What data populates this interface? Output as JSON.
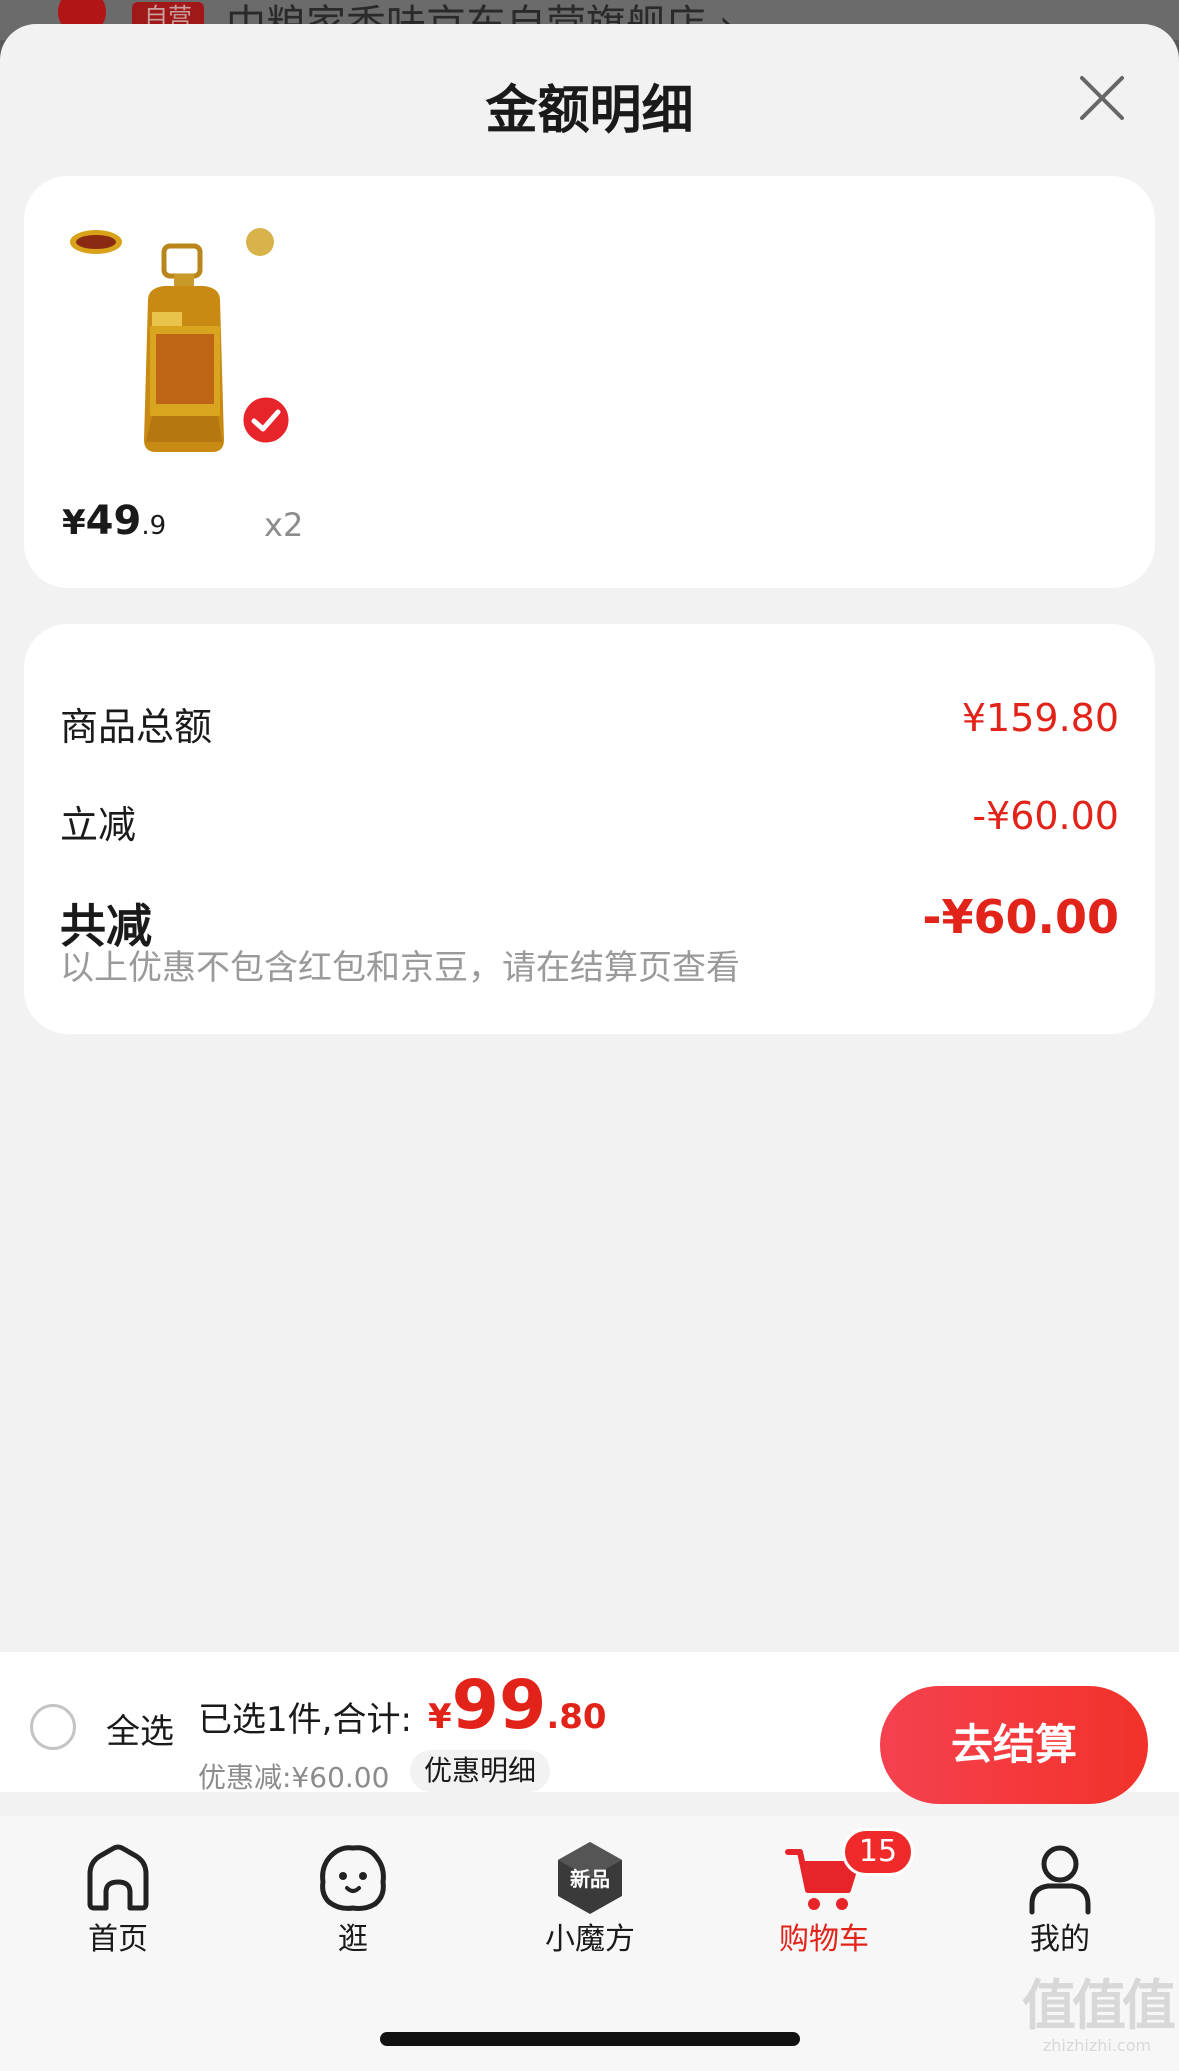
{
  "background": {
    "tag": "自营",
    "store_name": "中粮家香味京东自营旗舰店 ›"
  },
  "sheet": {
    "title": "金额明细"
  },
  "product": {
    "price_symbol": "¥",
    "price_int": "49",
    "price_dec": ".9",
    "quantity": "x2",
    "selected": true
  },
  "summary": {
    "goods_total_label": "商品总额",
    "goods_total_value": "¥159.80",
    "instant_discount_label": "立减",
    "instant_discount_value": "-¥60.00",
    "total_discount_label": "共减",
    "total_discount_value": "-¥60.00",
    "note": "以上优惠不包含红包和京豆，请在结算页查看"
  },
  "checkout": {
    "select_all_label": "全选",
    "selected_text": "已选1件,合计:",
    "total_symbol": "¥",
    "total_int": "99",
    "total_dec": ".80",
    "discount_text": "优惠减:¥60.00",
    "detail_chip": "优惠明细",
    "checkout_button": "去结算"
  },
  "tabs": [
    {
      "label": "首页",
      "icon": "home-icon"
    },
    {
      "label": "逛",
      "icon": "browse-icon"
    },
    {
      "label": "小魔方",
      "icon": "magic-cube-icon",
      "badge_text": "新品"
    },
    {
      "label": "购物车",
      "icon": "cart-icon",
      "active": true,
      "badge": "15"
    },
    {
      "label": "我的",
      "icon": "profile-icon"
    }
  ],
  "watermark": {
    "big": "值值值",
    "small": "zhizhizhi.com"
  },
  "colors": {
    "accent": "#e2231a",
    "sheet_bg": "#f2f2f2",
    "card_bg": "#ffffff"
  }
}
